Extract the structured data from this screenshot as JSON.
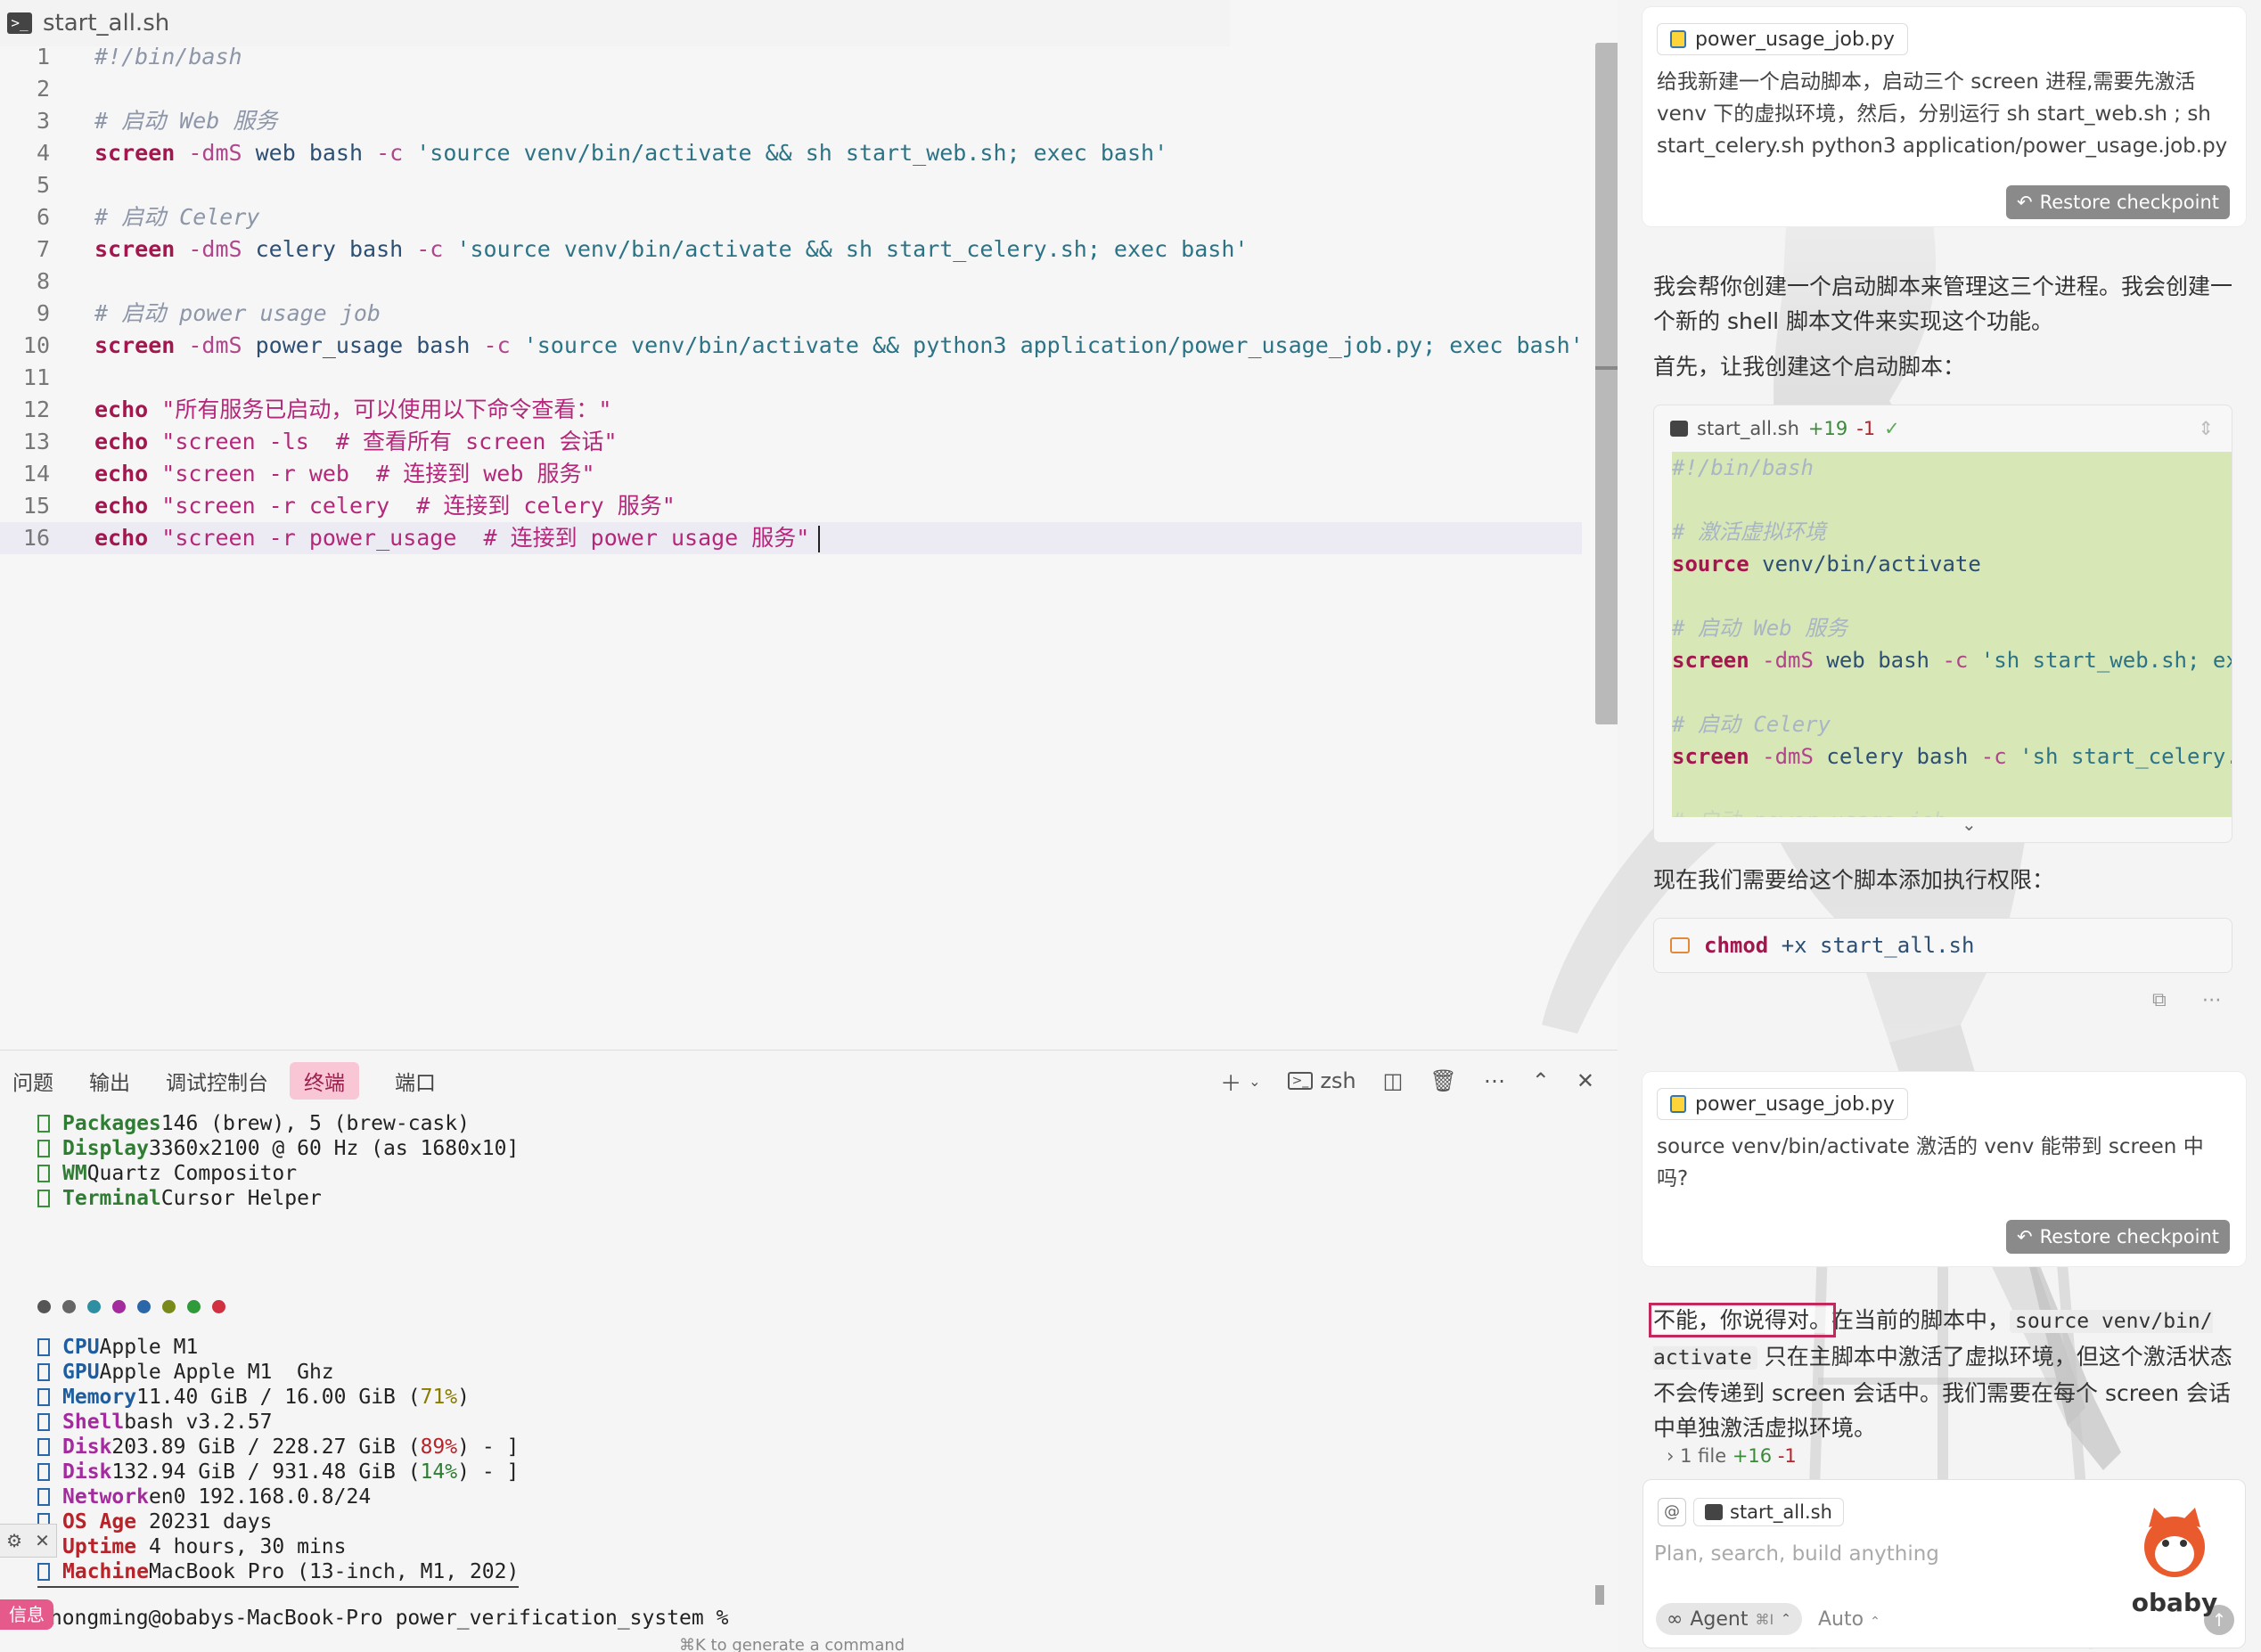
{
  "editor": {
    "tab_title": "start_all.sh",
    "lines": [
      {
        "n": "1",
        "t": [
          {
            "c": "cmt",
            "v": "#!/bin/bash"
          }
        ]
      },
      {
        "n": "2",
        "t": []
      },
      {
        "n": "3",
        "t": [
          {
            "c": "cmt",
            "v": "# 启动 Web 服务"
          }
        ]
      },
      {
        "n": "4",
        "t": [
          {
            "c": "kw",
            "v": "screen"
          },
          {
            "c": "op",
            "v": " -dmS"
          },
          {
            "c": "plain",
            "v": " web bash "
          },
          {
            "c": "op",
            "v": "-c"
          },
          {
            "c": "str",
            "v": " 'source venv/bin/activate && sh start_web.sh; exec bash'"
          }
        ]
      },
      {
        "n": "5",
        "t": []
      },
      {
        "n": "6",
        "t": [
          {
            "c": "cmt",
            "v": "# 启动 Celery"
          }
        ]
      },
      {
        "n": "7",
        "t": [
          {
            "c": "kw",
            "v": "screen"
          },
          {
            "c": "op",
            "v": " -dmS"
          },
          {
            "c": "plain",
            "v": " celery bash "
          },
          {
            "c": "op",
            "v": "-c"
          },
          {
            "c": "str",
            "v": " 'source venv/bin/activate && sh start_celery.sh; exec bash'"
          }
        ]
      },
      {
        "n": "8",
        "t": []
      },
      {
        "n": "9",
        "t": [
          {
            "c": "cmt",
            "v": "# 启动 power usage job"
          }
        ]
      },
      {
        "n": "10",
        "t": [
          {
            "c": "kw",
            "v": "screen"
          },
          {
            "c": "op",
            "v": " -dmS"
          },
          {
            "c": "plain",
            "v": " power_usage bash "
          },
          {
            "c": "op",
            "v": "-c"
          },
          {
            "c": "str",
            "v": " 'source venv/bin/activate && python3 application/power_usage_job.py; exec bash'"
          }
        ]
      },
      {
        "n": "11",
        "t": []
      },
      {
        "n": "12",
        "t": [
          {
            "c": "kw",
            "v": "echo"
          },
          {
            "c": "str2",
            "v": " \"所有服务已启动，可以使用以下命令查看：\""
          }
        ]
      },
      {
        "n": "13",
        "t": [
          {
            "c": "kw",
            "v": "echo"
          },
          {
            "c": "str2",
            "v": " \"screen -ls  # 查看所有 screen 会话\""
          }
        ]
      },
      {
        "n": "14",
        "t": [
          {
            "c": "kw",
            "v": "echo"
          },
          {
            "c": "str2",
            "v": " \"screen -r web  # 连接到 web 服务\""
          }
        ]
      },
      {
        "n": "15",
        "t": [
          {
            "c": "kw",
            "v": "echo"
          },
          {
            "c": "str2",
            "v": " \"screen -r celery  # 连接到 celery 服务\""
          }
        ]
      },
      {
        "n": "16",
        "t": [
          {
            "c": "kw",
            "v": "echo"
          },
          {
            "c": "str2",
            "v": " \"screen -r power_usage  # 连接到 power usage 服务\""
          }
        ],
        "active": true
      }
    ]
  },
  "panel": {
    "tabs": [
      "问题",
      "输出",
      "调试控制台",
      "终端",
      "端口"
    ],
    "active_tab": "终端",
    "shell_label": "zsh",
    "terminal": {
      "info_a": [
        {
          "k": "Packages",
          "v": "146 (brew), 5 (brew-cask)"
        },
        {
          "k": "Display",
          "v": "3360x2100 @ 60 Hz (as 1680x10]"
        },
        {
          "k": "WM",
          "v": "Quartz Compositor"
        },
        {
          "k": "Terminal",
          "v": "Cursor Helper"
        }
      ],
      "dot_colors": [
        "#555555",
        "#666666",
        "#2e8fa3",
        "#a32b9e",
        "#2b67a8",
        "#7a8a1a",
        "#2e9a3a",
        "#d03040"
      ],
      "info_b": [
        {
          "k": "CPU",
          "v": "Apple M1",
          "kc": "b"
        },
        {
          "k": "GPU",
          "v": "Apple Apple M1  Ghz",
          "kc": "b"
        },
        {
          "k": "Memory",
          "v": "11.40 GiB / 16.00 GiB (",
          "pct": "71%",
          "pc": "p71",
          "tail": ")",
          "kc": "b"
        },
        {
          "k": "Shell",
          "v": "bash v3.2.57",
          "kc": "m"
        },
        {
          "k": "Disk",
          "v": "203.89 GiB / 228.27 GiB (",
          "pct": "89%",
          "pc": "p89",
          "tail": ") - ]",
          "kc": "m"
        },
        {
          "k": "Disk",
          "v": "132.94 GiB / 931.48 GiB (",
          "pct": "14%",
          "pc": "p14",
          "tail": ") - ]",
          "kc": "m"
        },
        {
          "k": "Network",
          "v": "en0 192.168.0.8/24",
          "kc": "m"
        },
        {
          "k": "OS Age ",
          "v": "20231 days",
          "kc": "r"
        },
        {
          "k": "Uptime ",
          "v": "4 hours, 30 mins",
          "kc": "r"
        },
        {
          "k": "Machine",
          "v": "MacBook Pro (13-inch, M1, 202)",
          "kc": "r"
        }
      ],
      "prompt": "zhongming@obabys-MacBook-Pro power_verification_system %"
    },
    "generate_hint": "⌘K to generate a command",
    "side_info_label": "信息"
  },
  "chat": {
    "msg1": {
      "ref_file": "power_usage_job.py",
      "text": "给我新建一个启动脚本，启动三个 screen 进程,需要先激活 venv 下的虚拟环境，然后，分别运行 sh start_web.sh ; sh start_celery.sh python3 application/power_usage.job.py",
      "restore_label": "Restore checkpoint"
    },
    "reply1": "我会帮你创建一个启动脚本来管理这三个进程。我会创建一个新的 shell 脚本文件来实现这个功能。",
    "reply1b": "首先，让我创建这个启动脚本：",
    "codeblock": {
      "file": "start_all.sh",
      "added": "+19",
      "removed": "-1",
      "lines": [
        [
          {
            "c": "cmt",
            "v": "#!/bin/bash"
          }
        ],
        [],
        [
          {
            "c": "cmt",
            "v": "# 激活虚拟环境"
          }
        ],
        [
          {
            "c": "kw",
            "v": "source"
          },
          {
            "c": "plain",
            "v": " venv/bin/activate"
          }
        ],
        [],
        [
          {
            "c": "cmt",
            "v": "# 启动 Web 服务"
          }
        ],
        [
          {
            "c": "kw",
            "v": "screen"
          },
          {
            "c": "op",
            "v": " -dmS"
          },
          {
            "c": "plain",
            "v": " web bash "
          },
          {
            "c": "op",
            "v": "-c"
          },
          {
            "c": "str",
            "v": " 'sh start_web.sh; ex"
          }
        ],
        [],
        [
          {
            "c": "cmt",
            "v": "# 启动 Celery"
          }
        ],
        [
          {
            "c": "kw",
            "v": "screen"
          },
          {
            "c": "op",
            "v": " -dmS"
          },
          {
            "c": "plain",
            "v": " celery bash "
          },
          {
            "c": "op",
            "v": "-c"
          },
          {
            "c": "str",
            "v": " 'sh start_celery."
          }
        ],
        [],
        [
          {
            "c": "cmt",
            "v": "# 启动 power usage job"
          }
        ]
      ]
    },
    "reply2": "现在我们需要给这个脚本添加执行权限：",
    "chmod": {
      "cmd": "chmod",
      "args": " +x start_all.sh"
    },
    "msg2": {
      "ref_file": "power_usage_job.py",
      "text": "source venv/bin/activate 激活的 venv 能带到 screen 中吗?",
      "restore_label": "Restore checkpoint"
    },
    "reply3": {
      "highlight": "不能，你说得对。",
      "pre": "在当前的脚本中，",
      "code": "source venv/bin/ activate",
      "post": " 只在主脚本中激活了虚拟环境，但这个激活状态不会传递到 screen 会话中。我们需要在每个 screen 会话中单独激活虚拟环境。"
    },
    "files_changed": {
      "label": "1 file",
      "added": "+16",
      "removed": "-1"
    },
    "input": {
      "file_chip": "start_all.sh",
      "placeholder": "Plan, search, build anything",
      "agent_label": "Agent",
      "agent_kbd": "⌘I",
      "auto_label": "Auto"
    },
    "watermark": "obaby"
  }
}
